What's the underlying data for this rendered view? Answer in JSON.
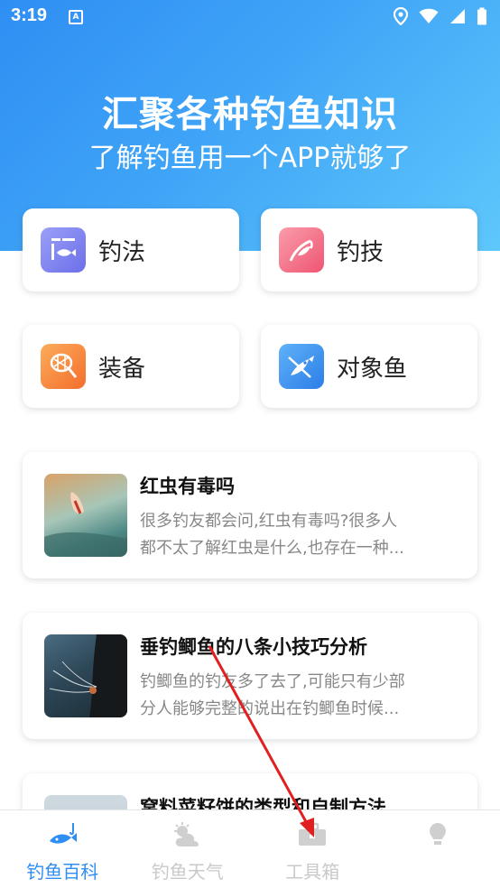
{
  "status": {
    "time": "3:19",
    "badge": "A"
  },
  "hero": {
    "title": "汇聚各种钓鱼知识",
    "subtitle": "了解钓鱼用一个APP就够了"
  },
  "categories": [
    {
      "label": "钓法",
      "icon": "fishing-method-icon",
      "color": "#7b7ff2"
    },
    {
      "label": "钓技",
      "icon": "fish-hook-icon",
      "color": "#f46f86"
    },
    {
      "label": "装备",
      "icon": "net-icon",
      "color": "#f88a3d"
    },
    {
      "label": "对象鱼",
      "icon": "target-fish-icon",
      "color": "#3d8ff2"
    }
  ],
  "articles": [
    {
      "title": "红虫有毒吗",
      "desc_line1": "很多钓友都会问,红虫有毒吗?很多人",
      "desc_line2": "都不太了解红虫是什么,也存在一种..."
    },
    {
      "title": "垂钓鲫鱼的八条小技巧分析",
      "desc_line1": "钓鲫鱼的钓友多了去了,可能只有少部",
      "desc_line2": "分人能够完整的说出在钓鲫鱼时候..."
    },
    {
      "title": "窝料菜籽饼的类型和自制方法"
    }
  ],
  "tabs": [
    {
      "label": "钓鱼百科",
      "icon": "fish-icon",
      "active": true
    },
    {
      "label": "钓鱼天气",
      "icon": "weather-icon",
      "active": false
    },
    {
      "label": "工具箱",
      "icon": "toolbox-icon",
      "active": false
    },
    {
      "label": "",
      "icon": "bulb-icon",
      "active": false
    }
  ],
  "colors": {
    "accent": "#2f8ef3",
    "annotation": "#e02020"
  }
}
